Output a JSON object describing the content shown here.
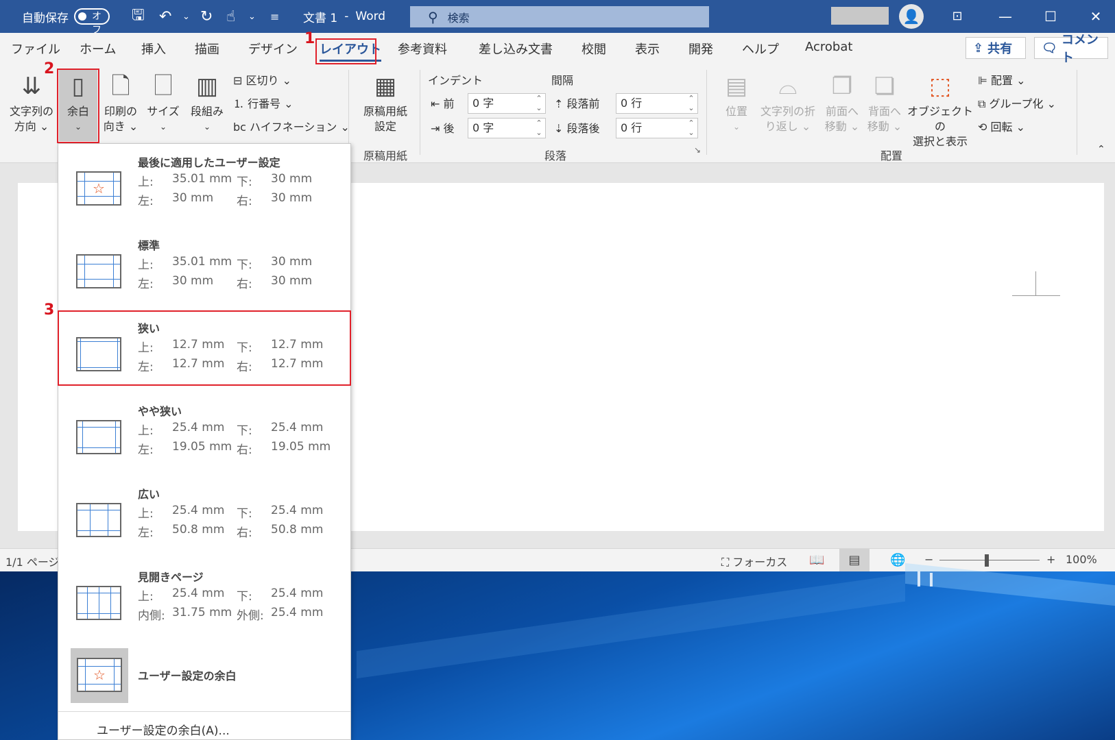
{
  "titlebar": {
    "autosave_label": "自動保存",
    "autosave_state": "オフ",
    "doc_title": "文書 1",
    "separator": "-",
    "app_name": "Word",
    "search_placeholder": "検索",
    "minimize": "—",
    "maximize": "☐",
    "close": "✕"
  },
  "tabs": [
    "ファイル",
    "ホーム",
    "挿入",
    "描画",
    "デザイン",
    "レイアウト",
    "参考資料",
    "差し込み文書",
    "校閲",
    "表示",
    "開発",
    "ヘルプ",
    "Acrobat"
  ],
  "actions": {
    "share": "共有",
    "comment": "コメント"
  },
  "ribbon": {
    "text_direction": [
      "文字列の",
      "方向 ⌄"
    ],
    "margins": "余白",
    "orientation": [
      "印刷の",
      "向き ⌄"
    ],
    "size": "サイズ",
    "columns": "段組み",
    "breaks": "区切り ⌄",
    "line_numbers": "行番号 ⌄",
    "hyphenation": "ハイフネーション ⌄",
    "genkou": [
      "原稿用紙",
      "設定"
    ],
    "group_genkou": "原稿用紙",
    "indent_label": "インデント",
    "spacing_label": "間隔",
    "indent_before_label": "前",
    "indent_before_value": "0 字",
    "indent_after_label": "後",
    "indent_after_value": "0 字",
    "space_before_label": "段落前",
    "space_before_value": "0 行",
    "space_after_label": "段落後",
    "space_after_value": "0 行",
    "group_paragraph": "段落",
    "position": "位置",
    "wrap_text": [
      "文字列の折",
      "り返し ⌄"
    ],
    "bring_forward": [
      "前面へ",
      "移動 ⌄"
    ],
    "send_backward": [
      "背面へ",
      "移動 ⌄"
    ],
    "selection_pane": [
      "オブジェクトの",
      "選択と表示"
    ],
    "align": "配置 ⌄",
    "group": "グループ化 ⌄",
    "rotate": "回転 ⌄",
    "group_arrange": "配置"
  },
  "margins_menu": {
    "options": [
      {
        "name": "最後に適用したユーザー設定",
        "top_label": "上:",
        "top": "35.01 mm",
        "bottom_label": "下:",
        "bottom": "30 mm",
        "left_label": "左:",
        "left": "30 mm",
        "right_label": "右:",
        "right": "30 mm"
      },
      {
        "name": "標準",
        "top_label": "上:",
        "top": "35.01 mm",
        "bottom_label": "下:",
        "bottom": "30 mm",
        "left_label": "左:",
        "left": "30 mm",
        "right_label": "右:",
        "right": "30 mm"
      },
      {
        "name": "狭い",
        "top_label": "上:",
        "top": "12.7 mm",
        "bottom_label": "下:",
        "bottom": "12.7 mm",
        "left_label": "左:",
        "left": "12.7 mm",
        "right_label": "右:",
        "right": "12.7 mm"
      },
      {
        "name": "やや狭い",
        "top_label": "上:",
        "top": "25.4 mm",
        "bottom_label": "下:",
        "bottom": "25.4 mm",
        "left_label": "左:",
        "left": "19.05 mm",
        "right_label": "右:",
        "right": "19.05 mm"
      },
      {
        "name": "広い",
        "top_label": "上:",
        "top": "25.4 mm",
        "bottom_label": "下:",
        "bottom": "25.4 mm",
        "left_label": "左:",
        "left": "50.8 mm",
        "right_label": "右:",
        "right": "50.8 mm"
      },
      {
        "name": "見開きページ",
        "top_label": "上:",
        "top": "25.4 mm",
        "bottom_label": "下:",
        "bottom": "25.4 mm",
        "left_label": "内側:",
        "left": "31.75 mm",
        "right_label": "外側:",
        "right": "25.4 mm"
      }
    ],
    "custom_label": "ユーザー設定の余白",
    "custom_link": "ユーザー設定の余白(A)..."
  },
  "status": {
    "page": "1/1 ページ",
    "focus": "フォーカス",
    "zoom": "100%",
    "zoom_level": 1.0
  },
  "annotations": {
    "step1": "1",
    "step2": "2",
    "step3": "3"
  },
  "colors": {
    "accent": "#2b579a",
    "annotation": "#e0202a"
  }
}
